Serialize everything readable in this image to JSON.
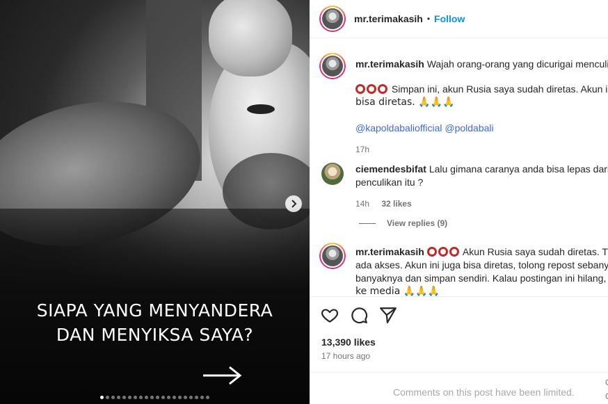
{
  "post": {
    "overlay_line1": "SIAPA YANG MENYANDERA",
    "overlay_line2": "DAN MENYIKSA SAYA?",
    "carousel_dot_count": 20,
    "carousel_active_index": 0
  },
  "header": {
    "username": "mr.terimakasih",
    "separator": "•",
    "follow_label": "Follow"
  },
  "caption": {
    "username": "mr.terimakasih",
    "line1": "Wajah orang-orang yang dicurigai menculik",
    "line2": "Simpan ini, akun Rusia saya sudah diretas. Akun i",
    "line3": "bisa diretas. 🙏🙏🙏",
    "mentions": "@kapoldabaliofficial @poldabali",
    "time": "17h"
  },
  "comments": [
    {
      "username": "ciemendesbifat",
      "text_line1": "Lalu gimana caranya anda bisa lepas dari",
      "text_line2": "penculikan itu ?",
      "time": "14h",
      "likes": "32 likes"
    },
    {
      "username": "mr.terimakasih",
      "text_line1": "Akun Rusia saya sudah diretas. Ti",
      "text_line2": "ada akses. Akun ini juga bisa diretas, tolong repost sebanya",
      "text_line3": "banyaknya dan simpan sendiri. Kalau postingan ini hilang, l",
      "text_line4": "ke media 🙏🙏🙏"
    }
  ],
  "view_replies": "View replies (9)",
  "likes_count": "13,390 likes",
  "posted_ago": "17 hours ago",
  "comments_limited": "Comments on this post have been limited.",
  "edge_chars": [
    "G",
    "G"
  ],
  "colors": {
    "follow": "#0095f6",
    "mention": "#4169e1",
    "muted": "#737373"
  }
}
